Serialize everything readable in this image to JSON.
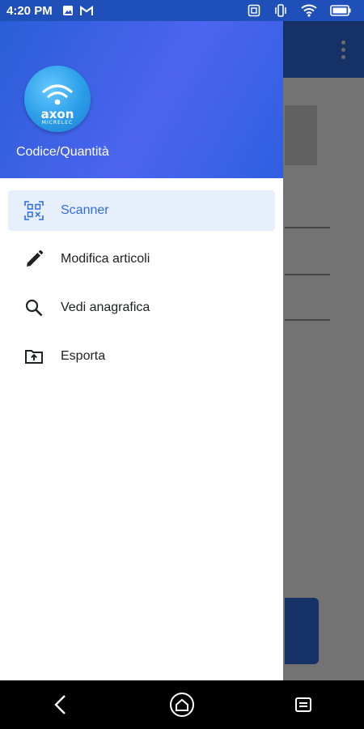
{
  "status_bar": {
    "time": "4:20 PM",
    "left_icons": [
      "image-icon",
      "gmail-icon"
    ],
    "right_icons": [
      "nfc-icon",
      "vibrate-icon",
      "wifi-icon",
      "battery-icon"
    ]
  },
  "drawer": {
    "header": {
      "logo_text": "axon",
      "logo_subtext": "MICRELEC",
      "title": "Codice/Quantità"
    },
    "items": [
      {
        "label": "Scanner",
        "icon": "qr-scan-icon",
        "active": true
      },
      {
        "label": "Modifica articoli",
        "icon": "pencil-icon",
        "active": false
      },
      {
        "label": "Vedi anagrafica",
        "icon": "search-icon",
        "active": false
      },
      {
        "label": "Esporta",
        "icon": "folder-upload-icon",
        "active": false
      }
    ]
  },
  "colors": {
    "primary": "#2f6de1",
    "active_item_bg": "#e7eefc",
    "status_bar": "#1f4fb8"
  },
  "nav_bar": {
    "buttons": [
      "back-icon",
      "home-icon",
      "recents-icon"
    ]
  }
}
